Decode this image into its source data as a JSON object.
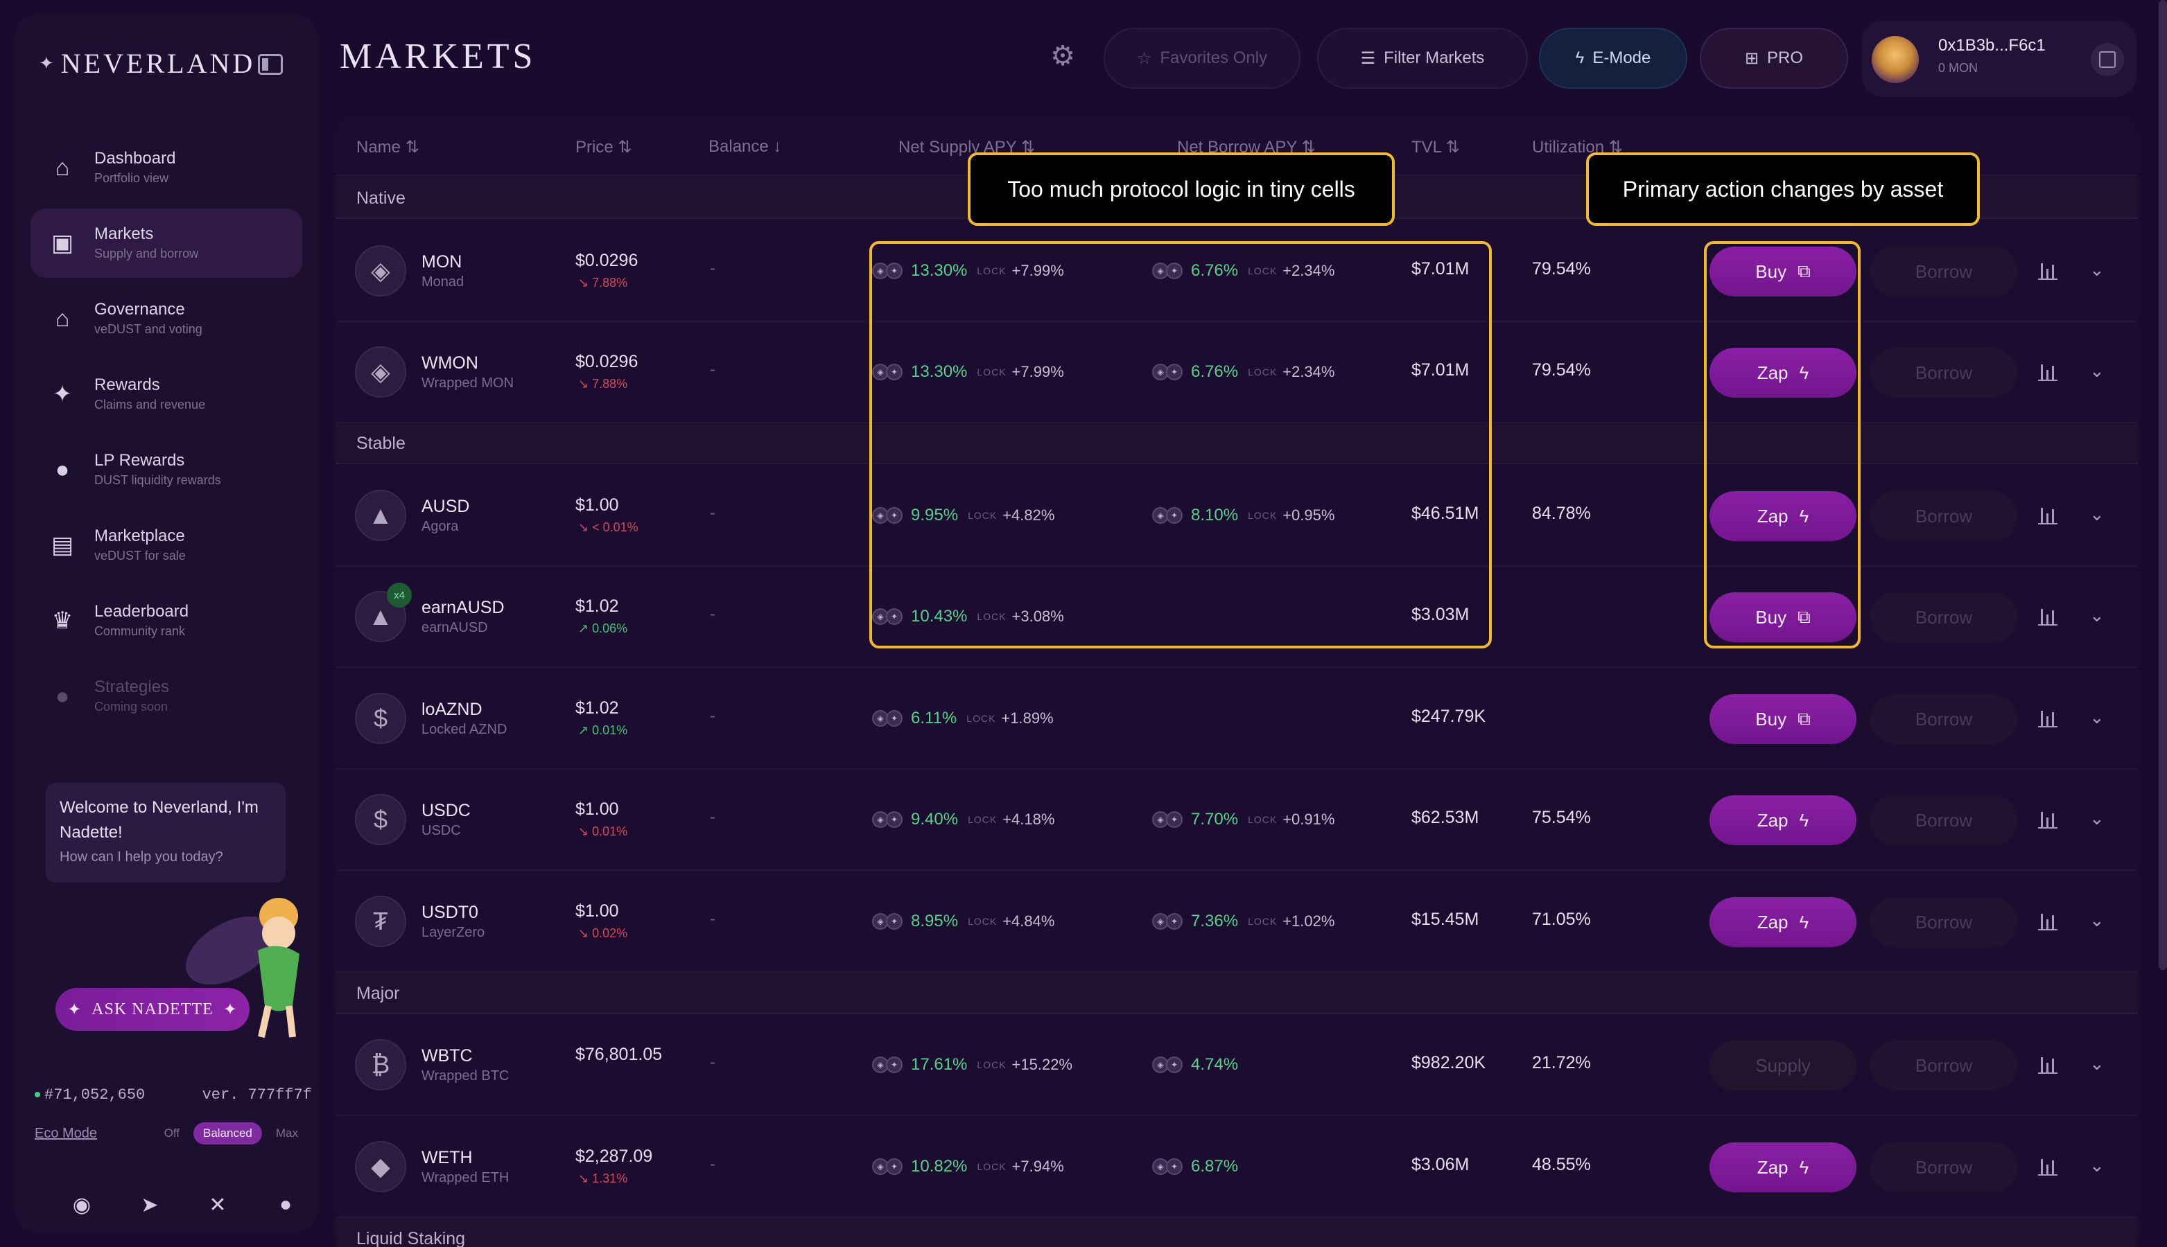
{
  "brand": {
    "name": "Neverland"
  },
  "sidebar": {
    "items": [
      {
        "label": "Dashboard",
        "sub": "Portfolio view",
        "icon": "home-icon"
      },
      {
        "label": "Markets",
        "sub": "Supply and borrow",
        "icon": "shopping-bag-icon"
      },
      {
        "label": "Governance",
        "sub": "veDUST and voting",
        "icon": "bank-icon"
      },
      {
        "label": "Rewards",
        "sub": "Claims and revenue",
        "icon": "sparkle-icon"
      },
      {
        "label": "LP Rewards",
        "sub": "DUST liquidity rewards",
        "icon": "droplet-icon"
      },
      {
        "label": "Marketplace",
        "sub": "veDUST for sale",
        "icon": "store-icon"
      },
      {
        "label": "Leaderboard",
        "sub": "Community rank",
        "icon": "crown-icon"
      },
      {
        "label": "Strategies",
        "sub": "Coming soon",
        "icon": "lightbulb-icon"
      }
    ],
    "chat": {
      "title": "Welcome to Neverland, I'm Nadette!",
      "sub": "How can I help you today?"
    },
    "ask_button": "Ask Nadette",
    "block": "#71,052,650",
    "version": "ver. 777ff7f",
    "eco": {
      "label": "Eco Mode",
      "options": [
        "Off",
        "Balanced",
        "Max"
      ],
      "selected": "Balanced"
    }
  },
  "header": {
    "title": "Markets",
    "favorites": "Favorites Only",
    "filter": "Filter Markets",
    "emode": "E-Mode",
    "pro": "PRO",
    "wallet": {
      "address": "0x1B3b...F6c1",
      "balance": "0 MON"
    }
  },
  "table": {
    "columns": [
      "Name",
      "Price",
      "Balance",
      "Net Supply APY",
      "Net Borrow APY",
      "TVL",
      "Utilization"
    ],
    "groups": [
      "Native",
      "Stable",
      "Major",
      "Liquid Staking"
    ],
    "lock_label": "LOCK",
    "borrow_label": "Borrow",
    "rows": [
      {
        "symbol": "MON",
        "name": "Monad",
        "price": "$0.0296",
        "change": "↘ 7.88%",
        "balance": "-",
        "supply": "13.30%",
        "supply_lock": "+7.99%",
        "borrow": "6.76%",
        "borrow_lock": "+2.34%",
        "tvl": "$7.01M",
        "util": "79.54%",
        "action": "Buy"
      },
      {
        "symbol": "WMON",
        "name": "Wrapped MON",
        "price": "$0.0296",
        "change": "↘ 7.88%",
        "balance": "-",
        "supply": "13.30%",
        "supply_lock": "+7.99%",
        "borrow": "6.76%",
        "borrow_lock": "+2.34%",
        "tvl": "$7.01M",
        "util": "79.54%",
        "action": "Zap"
      },
      {
        "symbol": "AUSD",
        "name": "Agora",
        "price": "$1.00",
        "change": "↘ < 0.01%",
        "balance": "-",
        "supply": "9.95%",
        "supply_lock": "+4.82%",
        "borrow": "8.10%",
        "borrow_lock": "+0.95%",
        "tvl": "$46.51M",
        "util": "84.78%",
        "action": "Zap"
      },
      {
        "symbol": "earnAUSD",
        "name": "earnAUSD",
        "price": "$1.02",
        "change": "↗ 0.06%",
        "balance": "-",
        "supply": "10.43%",
        "supply_lock": "+3.08%",
        "borrow": "",
        "borrow_lock": "",
        "tvl": "$3.03M",
        "util": "",
        "action": "Buy",
        "badge": "x4"
      },
      {
        "symbol": "loAZND",
        "name": "Locked AZND",
        "price": "$1.02",
        "change": "↗ 0.01%",
        "balance": "-",
        "supply": "6.11%",
        "supply_lock": "+1.89%",
        "borrow": "",
        "borrow_lock": "",
        "tvl": "$247.79K",
        "util": "",
        "action": "Buy"
      },
      {
        "symbol": "USDC",
        "name": "USDC",
        "price": "$1.00",
        "change": "↘ 0.01%",
        "balance": "-",
        "supply": "9.40%",
        "supply_lock": "+4.18%",
        "borrow": "7.70%",
        "borrow_lock": "+0.91%",
        "tvl": "$62.53M",
        "util": "75.54%",
        "action": "Zap"
      },
      {
        "symbol": "USDT0",
        "name": "LayerZero",
        "price": "$1.00",
        "change": "↘ 0.02%",
        "balance": "-",
        "supply": "8.95%",
        "supply_lock": "+4.84%",
        "borrow": "7.36%",
        "borrow_lock": "+1.02%",
        "tvl": "$15.45M",
        "util": "71.05%",
        "action": "Zap"
      },
      {
        "symbol": "WBTC",
        "name": "Wrapped BTC",
        "price": "$76,801.05",
        "change": "",
        "balance": "-",
        "supply": "17.61%",
        "supply_lock": "+15.22%",
        "borrow": "4.74%",
        "borrow_lock": "",
        "tvl": "$982.20K",
        "util": "21.72%",
        "action": "Supply"
      },
      {
        "symbol": "WETH",
        "name": "Wrapped ETH",
        "price": "$2,287.09",
        "change": "↘ 1.31%",
        "balance": "-",
        "supply": "10.82%",
        "supply_lock": "+7.94%",
        "borrow": "6.87%",
        "borrow_lock": "",
        "tvl": "$3.06M",
        "util": "48.55%",
        "action": "Zap"
      }
    ]
  },
  "annotations": {
    "left": "Too much protocol logic in tiny cells",
    "right": "Primary action changes by asset"
  }
}
